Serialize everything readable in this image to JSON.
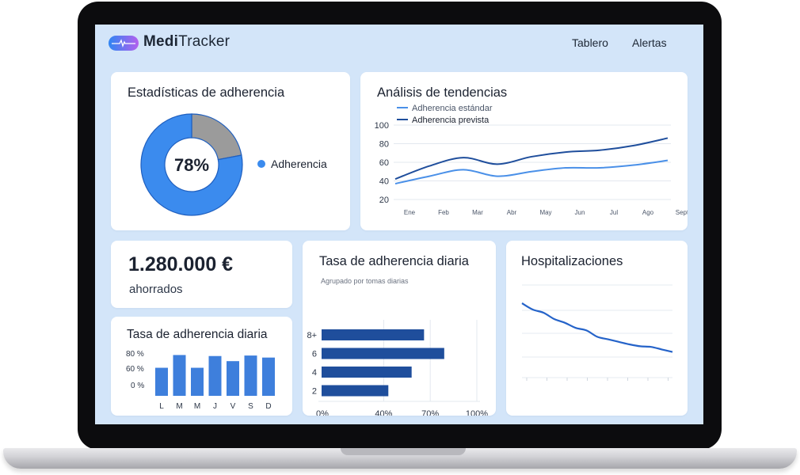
{
  "app": {
    "name_bold": "Medi",
    "name_light": "Tracker"
  },
  "nav": {
    "items": [
      "Tablero",
      "Alertas"
    ]
  },
  "colors": {
    "accent": "#2f86f2",
    "dark_blue": "#1f4e9c",
    "bar_blue": "#3e7fdc",
    "gray": "#9b9b9b",
    "screen_bg": "#d3e5f9"
  },
  "adherence_stats": {
    "title": "Estadísticas de adherencia",
    "center_label": "78%",
    "legend": "Adherencia",
    "chart_data": {
      "type": "pie",
      "labels": [
        "Adherencia",
        ""
      ],
      "values": [
        78,
        22
      ],
      "colors": [
        "#3b8bee",
        "#9b9b9b"
      ]
    }
  },
  "trends": {
    "title": "Análisis de tendencias",
    "legend": [
      "Adherencia estándar",
      "Adherencia prevista"
    ],
    "chart_data": {
      "type": "line",
      "x": [
        "Ene",
        "Feb",
        "Mar",
        "Abr",
        "May",
        "Jun",
        "Jul",
        "Ago",
        "Sept"
      ],
      "ylim": [
        20,
        100
      ],
      "yticks": [
        "100",
        "80",
        "60",
        "40",
        "20"
      ],
      "series": [
        {
          "name": "Adherencia estándar",
          "values": [
            37,
            45,
            52,
            45,
            50,
            54,
            54,
            57,
            62
          ],
          "color": "#4a90e8"
        },
        {
          "name": "Adherencia prevista",
          "values": [
            42,
            56,
            65,
            58,
            66,
            71,
            73,
            78,
            86
          ],
          "color": "#1f4e9c"
        }
      ]
    }
  },
  "savings": {
    "amount": "1.280.000 €",
    "label": "ahorrados"
  },
  "daily_small": {
    "title": "Tasa de adherencia diaria",
    "yticks": [
      "80 %",
      "60 %",
      "0 %"
    ],
    "chart_data": {
      "type": "bar",
      "categories": [
        "L",
        "M",
        "M",
        "J",
        "V",
        "S",
        "D"
      ],
      "values": [
        55,
        80,
        55,
        78,
        68,
        79,
        75
      ],
      "ylim": [
        0,
        90
      ]
    }
  },
  "daily_grouped": {
    "title": "Tasa de adherencia diaria",
    "subtitle": "Agrupado por tomas diarias",
    "chart_data": {
      "type": "bar",
      "orientation": "horizontal",
      "categories": [
        "8+",
        "6",
        "4",
        "2"
      ],
      "values": [
        66,
        79,
        58,
        43
      ],
      "xticks": [
        "0%",
        "40%",
        "70%",
        "100%"
      ],
      "xlim": [
        0,
        100
      ]
    }
  },
  "hospitalizations": {
    "title": "Hospitalizaciones",
    "chart_data": {
      "type": "line",
      "x": [
        0,
        1,
        2,
        3,
        4,
        5,
        6,
        7,
        8,
        9,
        10,
        11,
        12,
        13,
        14
      ],
      "ylim": [
        0,
        100
      ],
      "series": [
        {
          "values": [
            95,
            85,
            80,
            70,
            64,
            56,
            52,
            42,
            38,
            34,
            30,
            27,
            26,
            22,
            18
          ]
        }
      ]
    }
  }
}
